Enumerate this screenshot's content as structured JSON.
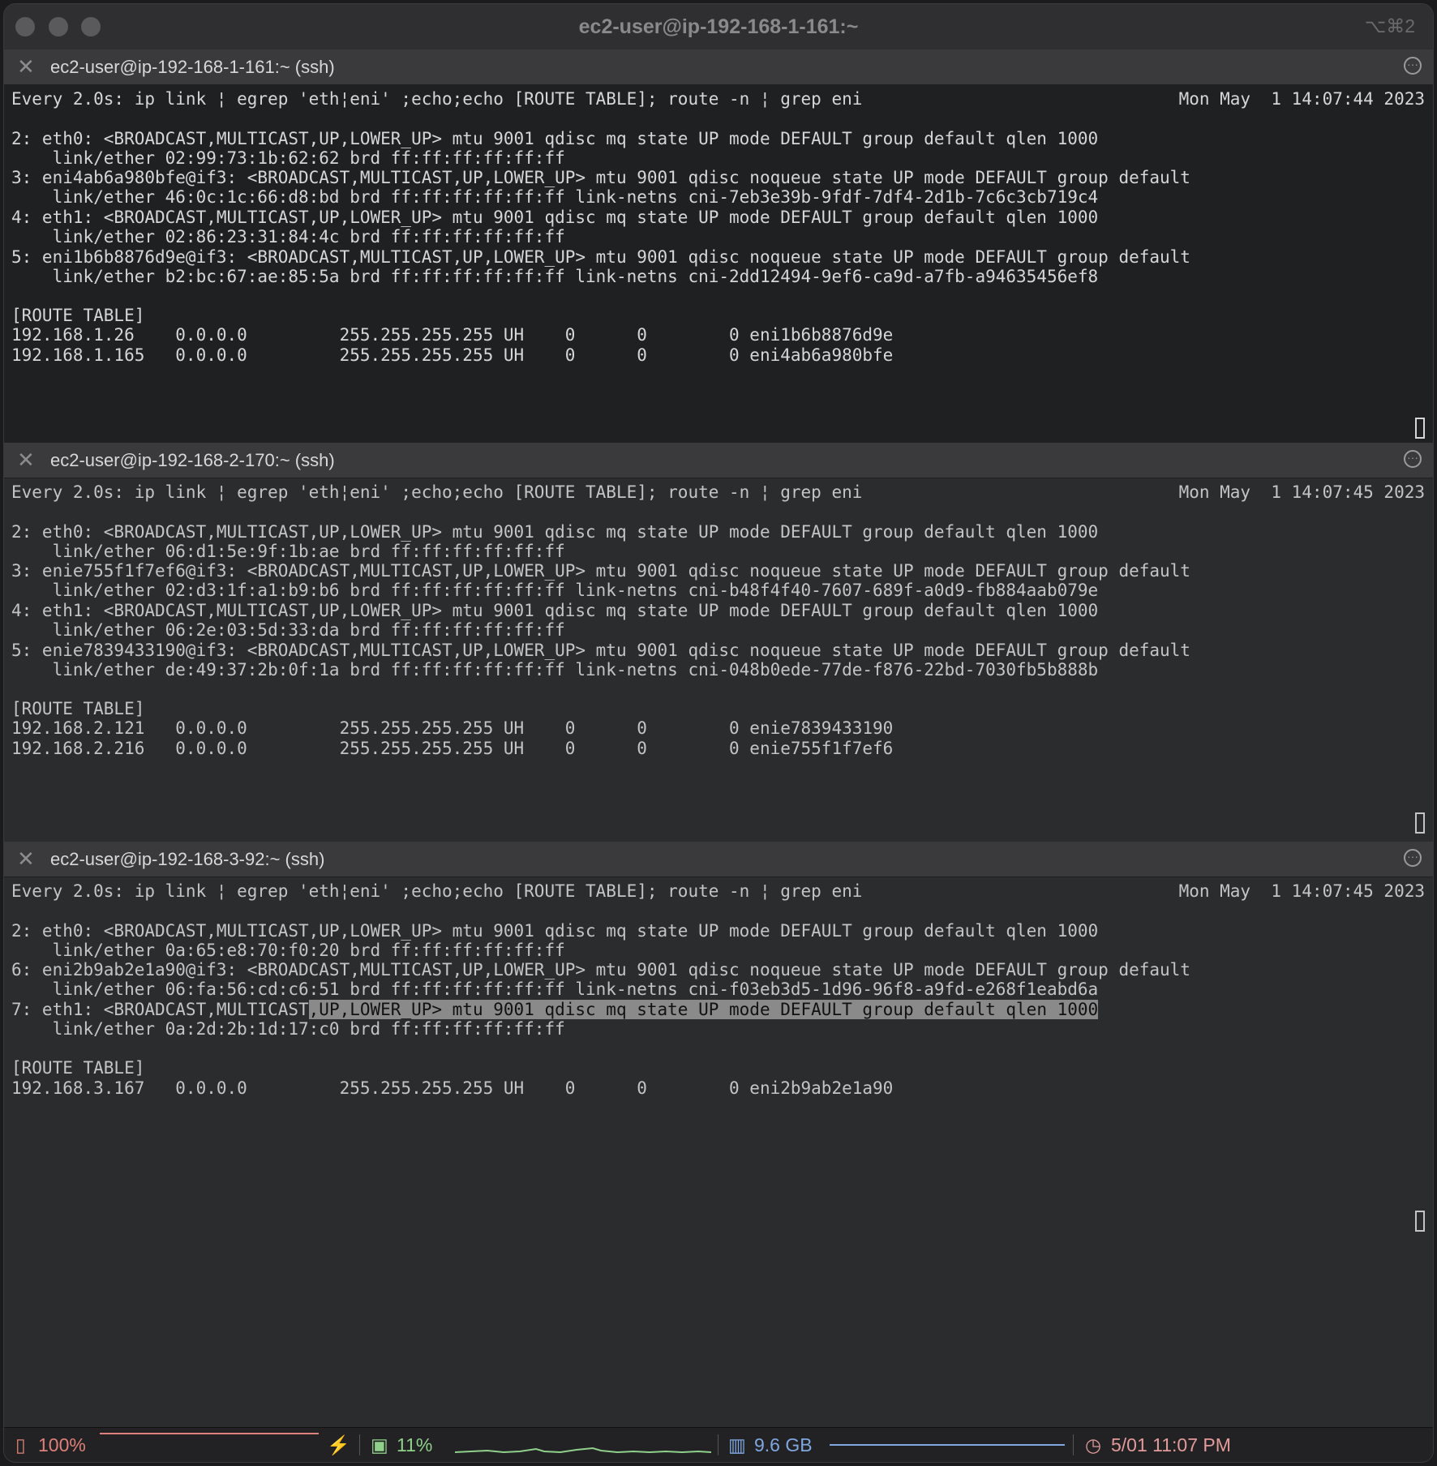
{
  "window": {
    "title": "ec2-user@ip-192-168-1-161:~",
    "shortcut": "⌥⌘2"
  },
  "command": "Every 2.0s: ip link ¦ egrep 'eth¦eni' ;echo;echo [ROUTE TABLE]; route -n ¦ grep eni",
  "panes": [
    {
      "title": "ec2-user@ip-192-168-1-161:~ (ssh)",
      "time": "Mon May  1 14:07:44 2023",
      "lines": [
        "2: eth0: <BROADCAST,MULTICAST,UP,LOWER_UP> mtu 9001 qdisc mq state UP mode DEFAULT group default qlen 1000",
        "    link/ether 02:99:73:1b:62:62 brd ff:ff:ff:ff:ff:ff",
        "3: eni4ab6a980bfe@if3: <BROADCAST,MULTICAST,UP,LOWER_UP> mtu 9001 qdisc noqueue state UP mode DEFAULT group default",
        "    link/ether 46:0c:1c:66:d8:bd brd ff:ff:ff:ff:ff:ff link-netns cni-7eb3e39b-9fdf-7df4-2d1b-7c6c3cb719c4",
        "4: eth1: <BROADCAST,MULTICAST,UP,LOWER_UP> mtu 9001 qdisc mq state UP mode DEFAULT group default qlen 1000",
        "    link/ether 02:86:23:31:84:4c brd ff:ff:ff:ff:ff:ff",
        "5: eni1b6b8876d9e@if3: <BROADCAST,MULTICAST,UP,LOWER_UP> mtu 9001 qdisc noqueue state UP mode DEFAULT group default",
        "    link/ether b2:bc:67:ae:85:5a brd ff:ff:ff:ff:ff:ff link-netns cni-2dd12494-9ef6-ca9d-a7fb-a94635456ef8",
        "",
        "[ROUTE TABLE]",
        "192.168.1.26    0.0.0.0         255.255.255.255 UH    0      0        0 eni1b6b8876d9e",
        "192.168.1.165   0.0.0.0         255.255.255.255 UH    0      0        0 eni4ab6a980bfe"
      ]
    },
    {
      "title": "ec2-user@ip-192-168-2-170:~ (ssh)",
      "time": "Mon May  1 14:07:45 2023",
      "lines": [
        "2: eth0: <BROADCAST,MULTICAST,UP,LOWER_UP> mtu 9001 qdisc mq state UP mode DEFAULT group default qlen 1000",
        "    link/ether 06:d1:5e:9f:1b:ae brd ff:ff:ff:ff:ff:ff",
        "3: enie755f1f7ef6@if3: <BROADCAST,MULTICAST,UP,LOWER_UP> mtu 9001 qdisc noqueue state UP mode DEFAULT group default",
        "    link/ether 02:d3:1f:a1:b9:b6 brd ff:ff:ff:ff:ff:ff link-netns cni-b48f4f40-7607-689f-a0d9-fb884aab079e",
        "4: eth1: <BROADCAST,MULTICAST,UP,LOWER_UP> mtu 9001 qdisc mq state UP mode DEFAULT group default qlen 1000",
        "    link/ether 06:2e:03:5d:33:da brd ff:ff:ff:ff:ff:ff",
        "5: enie7839433190@if3: <BROADCAST,MULTICAST,UP,LOWER_UP> mtu 9001 qdisc noqueue state UP mode DEFAULT group default",
        "    link/ether de:49:37:2b:0f:1a brd ff:ff:ff:ff:ff:ff link-netns cni-048b0ede-77de-f876-22bd-7030fb5b888b",
        "",
        "[ROUTE TABLE]",
        "192.168.2.121   0.0.0.0         255.255.255.255 UH    0      0        0 enie7839433190",
        "192.168.2.216   0.0.0.0         255.255.255.255 UH    0      0        0 enie755f1f7ef6"
      ]
    },
    {
      "title": "ec2-user@ip-192-168-3-92:~ (ssh)",
      "time": "Mon May  1 14:07:45 2023",
      "lines": [
        "2: eth0: <BROADCAST,MULTICAST,UP,LOWER_UP> mtu 9001 qdisc mq state UP mode DEFAULT group default qlen 1000",
        "    link/ether 0a:65:e8:70:f0:20 brd ff:ff:ff:ff:ff:ff",
        "6: eni2b9ab2e1a90@if3: <BROADCAST,MULTICAST,UP,LOWER_UP> mtu 9001 qdisc noqueue state UP mode DEFAULT group default",
        "    link/ether 06:fa:56:cd:c6:51 brd ff:ff:ff:ff:ff:ff link-netns cni-f03eb3d5-1d96-96f8-a9fd-e268f1eabd6a",
        "7: eth1: <BROADCAST,MULTICAST,UP,LOWER_UP> mtu 9001 qdisc mq state UP mode DEFAULT group default qlen 1000",
        "    link/ether 0a:2d:2b:1d:17:c0 brd ff:ff:ff:ff:ff:ff",
        "",
        "[ROUTE TABLE]",
        "192.168.3.167   0.0.0.0         255.255.255.255 UH    0      0        0 eni2b9ab2e1a90"
      ]
    }
  ],
  "statusbar": {
    "battery": "100%",
    "cpu": "11%",
    "memory": "9.6 GB",
    "clock": "5/01 11:07 PM",
    "colors": {
      "battery": "#e0807a",
      "cpu": "#8fd08a",
      "memory": "#7fa7e0",
      "clock": "#e39a9a"
    }
  }
}
